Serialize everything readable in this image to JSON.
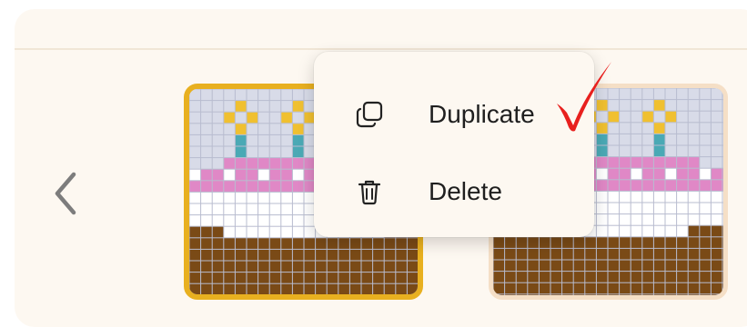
{
  "menu": {
    "items": [
      {
        "label": "Duplicate",
        "icon": "duplicate-icon"
      },
      {
        "label": "Delete",
        "icon": "trash-icon"
      }
    ]
  },
  "colors": {
    "panel_bg": "#fdf8f1",
    "selected_border": "#e8b020",
    "thumb_border": "#f5dfc6",
    "check_mark": "#e8201e"
  }
}
